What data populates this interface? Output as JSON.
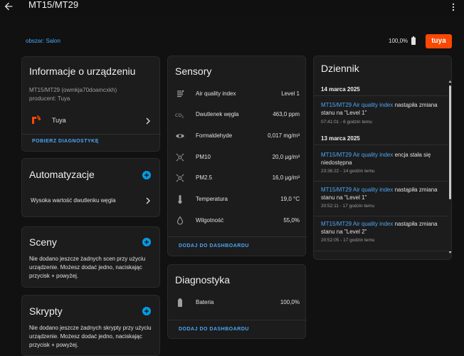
{
  "topbar": {
    "title": "MT15/MT29"
  },
  "header": {
    "area_link": "obszar: Salon",
    "battery": "100,0%",
    "brand": "tuya"
  },
  "info": {
    "title": "Informacje o urządzeniu",
    "model": "MT15/MT29 (owmkja70doamcxkh)",
    "producer": "producent: Tuya",
    "integration": "Tuya",
    "action": "POBIERZ DIAGNOSTYKĘ"
  },
  "automations": {
    "title": "Automatyzacje",
    "items": [
      "Wysoka wartość dwutlenku węgla"
    ]
  },
  "scenes": {
    "title": "Sceny",
    "empty": "Nie dodano jeszcze żadnych scen przy użyciu urządzenie. Możesz dodać jedno, naciskając przycisk + powyżej."
  },
  "scripts": {
    "title": "Skrypty",
    "empty": "Nie dodano jeszcze żadnych skrypty przy użyciu urządzenie. Możesz dodać jedno, naciskając przycisk + powyżej."
  },
  "sensors": {
    "title": "Sensory",
    "items": [
      {
        "name": "Air quality index",
        "value": "Level 1",
        "icon": "air-quality-icon"
      },
      {
        "name": "Dwutlenek węgla",
        "value": "463,0 ppm",
        "icon": "co2-icon"
      },
      {
        "name": "Formaldehyde",
        "value": "0,017 mg/m³",
        "icon": "eye-icon"
      },
      {
        "name": "PM10",
        "value": "20,0 µg/m³",
        "icon": "particles-icon"
      },
      {
        "name": "PM2.5",
        "value": "16,0 µg/m³",
        "icon": "particles-icon"
      },
      {
        "name": "Temperatura",
        "value": "19,0 °C",
        "icon": "thermometer-icon"
      },
      {
        "name": "Wilgotność",
        "value": "55,0%",
        "icon": "water-drop-icon"
      }
    ],
    "action": "DODAJ DO DASHBOARDU"
  },
  "diagnostics": {
    "title": "Diagnostyka",
    "items": [
      {
        "name": "Bateria",
        "value": "100,0%",
        "icon": "battery-icon"
      }
    ],
    "action": "DODAJ DO DASHBOARDU"
  },
  "log": {
    "title": "Dziennik",
    "dates": [
      "14 marca 2025",
      "13 marca 2025"
    ],
    "entries": [
      {
        "link": "MT15/MT29 Air quality index",
        "text": " nastąpiła zmiana stanu na \"Level 1\"",
        "time": "07:41:01 - 6 godzin temu"
      },
      {
        "link": "MT15/MT29 Air quality index",
        "text": " encja stała się niedostępna",
        "time": "23:36:22 - 14 godzin temu"
      },
      {
        "link": "MT15/MT29 Air quality index",
        "text": " nastąpiła zmiana stanu na \"Level 1\"",
        "time": "20:52:11 - 17 godzin temu"
      },
      {
        "link": "MT15/MT29 Air quality index",
        "text": " nastąpiła zmiana stanu na \"Level 2\"",
        "time": "20:52:05 - 17 godzin temu"
      }
    ]
  },
  "colors": {
    "accent": "#4da6f5",
    "plus": "#039be5",
    "tuya": "#ff4800",
    "card": "#1c1c1c",
    "background": "#111111"
  }
}
